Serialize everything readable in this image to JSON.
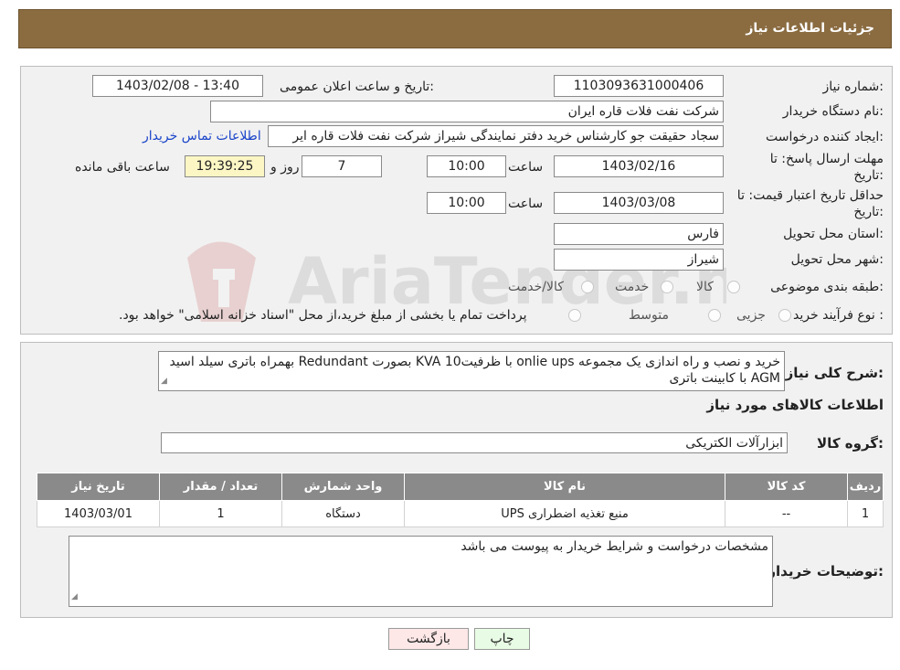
{
  "header": {
    "title": "جزئیات اطلاعات نیاز"
  },
  "need": {
    "number_label": "شماره نیاز:",
    "number": "1103093631000406",
    "announce_label": "تاریخ و ساعت اعلان عمومی:",
    "announce_value": "1403/02/08 - 13:40",
    "buyer_org_label": "نام دستگاه خریدار:",
    "buyer_org": "شرکت نفت فلات قاره ایران",
    "creator_label": "ایجاد کننده درخواست:",
    "creator": "سجاد حقیقت جو کارشناس خرید دفتر نمایندگی شیراز شرکت نفت فلات قاره ایر",
    "contact_link": "اطلاعات تماس خریدار",
    "deadline_label": "مهلت ارسال پاسخ: تا",
    "deadline_label2": "تاریخ:",
    "deadline_date": "1403/02/16",
    "time_label": "ساعت",
    "deadline_time": "10:00",
    "days": "7",
    "days_label": "روز و",
    "remaining": "19:39:25",
    "remaining_label": "ساعت باقی مانده",
    "validity_label": "حداقل تاریخ اعتبار قیمت: تا",
    "validity_label2": "تاریخ:",
    "validity_date": "1403/03/08",
    "validity_time": "10:00",
    "province_label": "استان محل تحویل:",
    "province": "فارس",
    "city_label": "شهر محل تحویل:",
    "city": "شیراز",
    "category_label": "طبقه بندی موضوعی:",
    "category_options": [
      "کالا",
      "خدمت",
      "کالا/خدمت"
    ],
    "process_label": "نوع فرآیند خرید :",
    "process_options": [
      "جزیی",
      "متوسط"
    ],
    "process_note": "پرداخت تمام یا بخشی از مبلغ خرید،از محل \"اسناد خزانه اسلامی\" خواهد بود."
  },
  "description": {
    "label": "شرح کلی نیاز:",
    "text": "خرید و نصب و راه اندازی یک مجموعه onlie ups  با ظرفیت10  KVA بصورت Redundant  بهمراه باتری سیلد اسید AGM با کابینت باتری",
    "items_title": "اطلاعات کالاهای مورد نیاز",
    "group_label": "گروه کالا:",
    "group_value": "ابزارآلات الکتریکی"
  },
  "table": {
    "headers": [
      "ردیف",
      "کد کالا",
      "نام کالا",
      "واحد شمارش",
      "تعداد / مقدار",
      "تاریخ نیاز"
    ],
    "rows": [
      [
        "1",
        "--",
        "منبع تغذیه اضطراری UPS",
        "دستگاه",
        "1",
        "1403/03/01"
      ]
    ]
  },
  "buyer_notes": {
    "label": "توضیحات خریدار:",
    "text": "مشخصات درخواست و شرایط خریدار به پیوست می باشد"
  },
  "buttons": {
    "back": "بازگشت",
    "print": "چاپ"
  },
  "colors": {
    "header_bg": "#8b6c41",
    "link": "#1a44c9",
    "table_header": "#8a8a8a",
    "remaining_bg": "#fbf6c4"
  }
}
